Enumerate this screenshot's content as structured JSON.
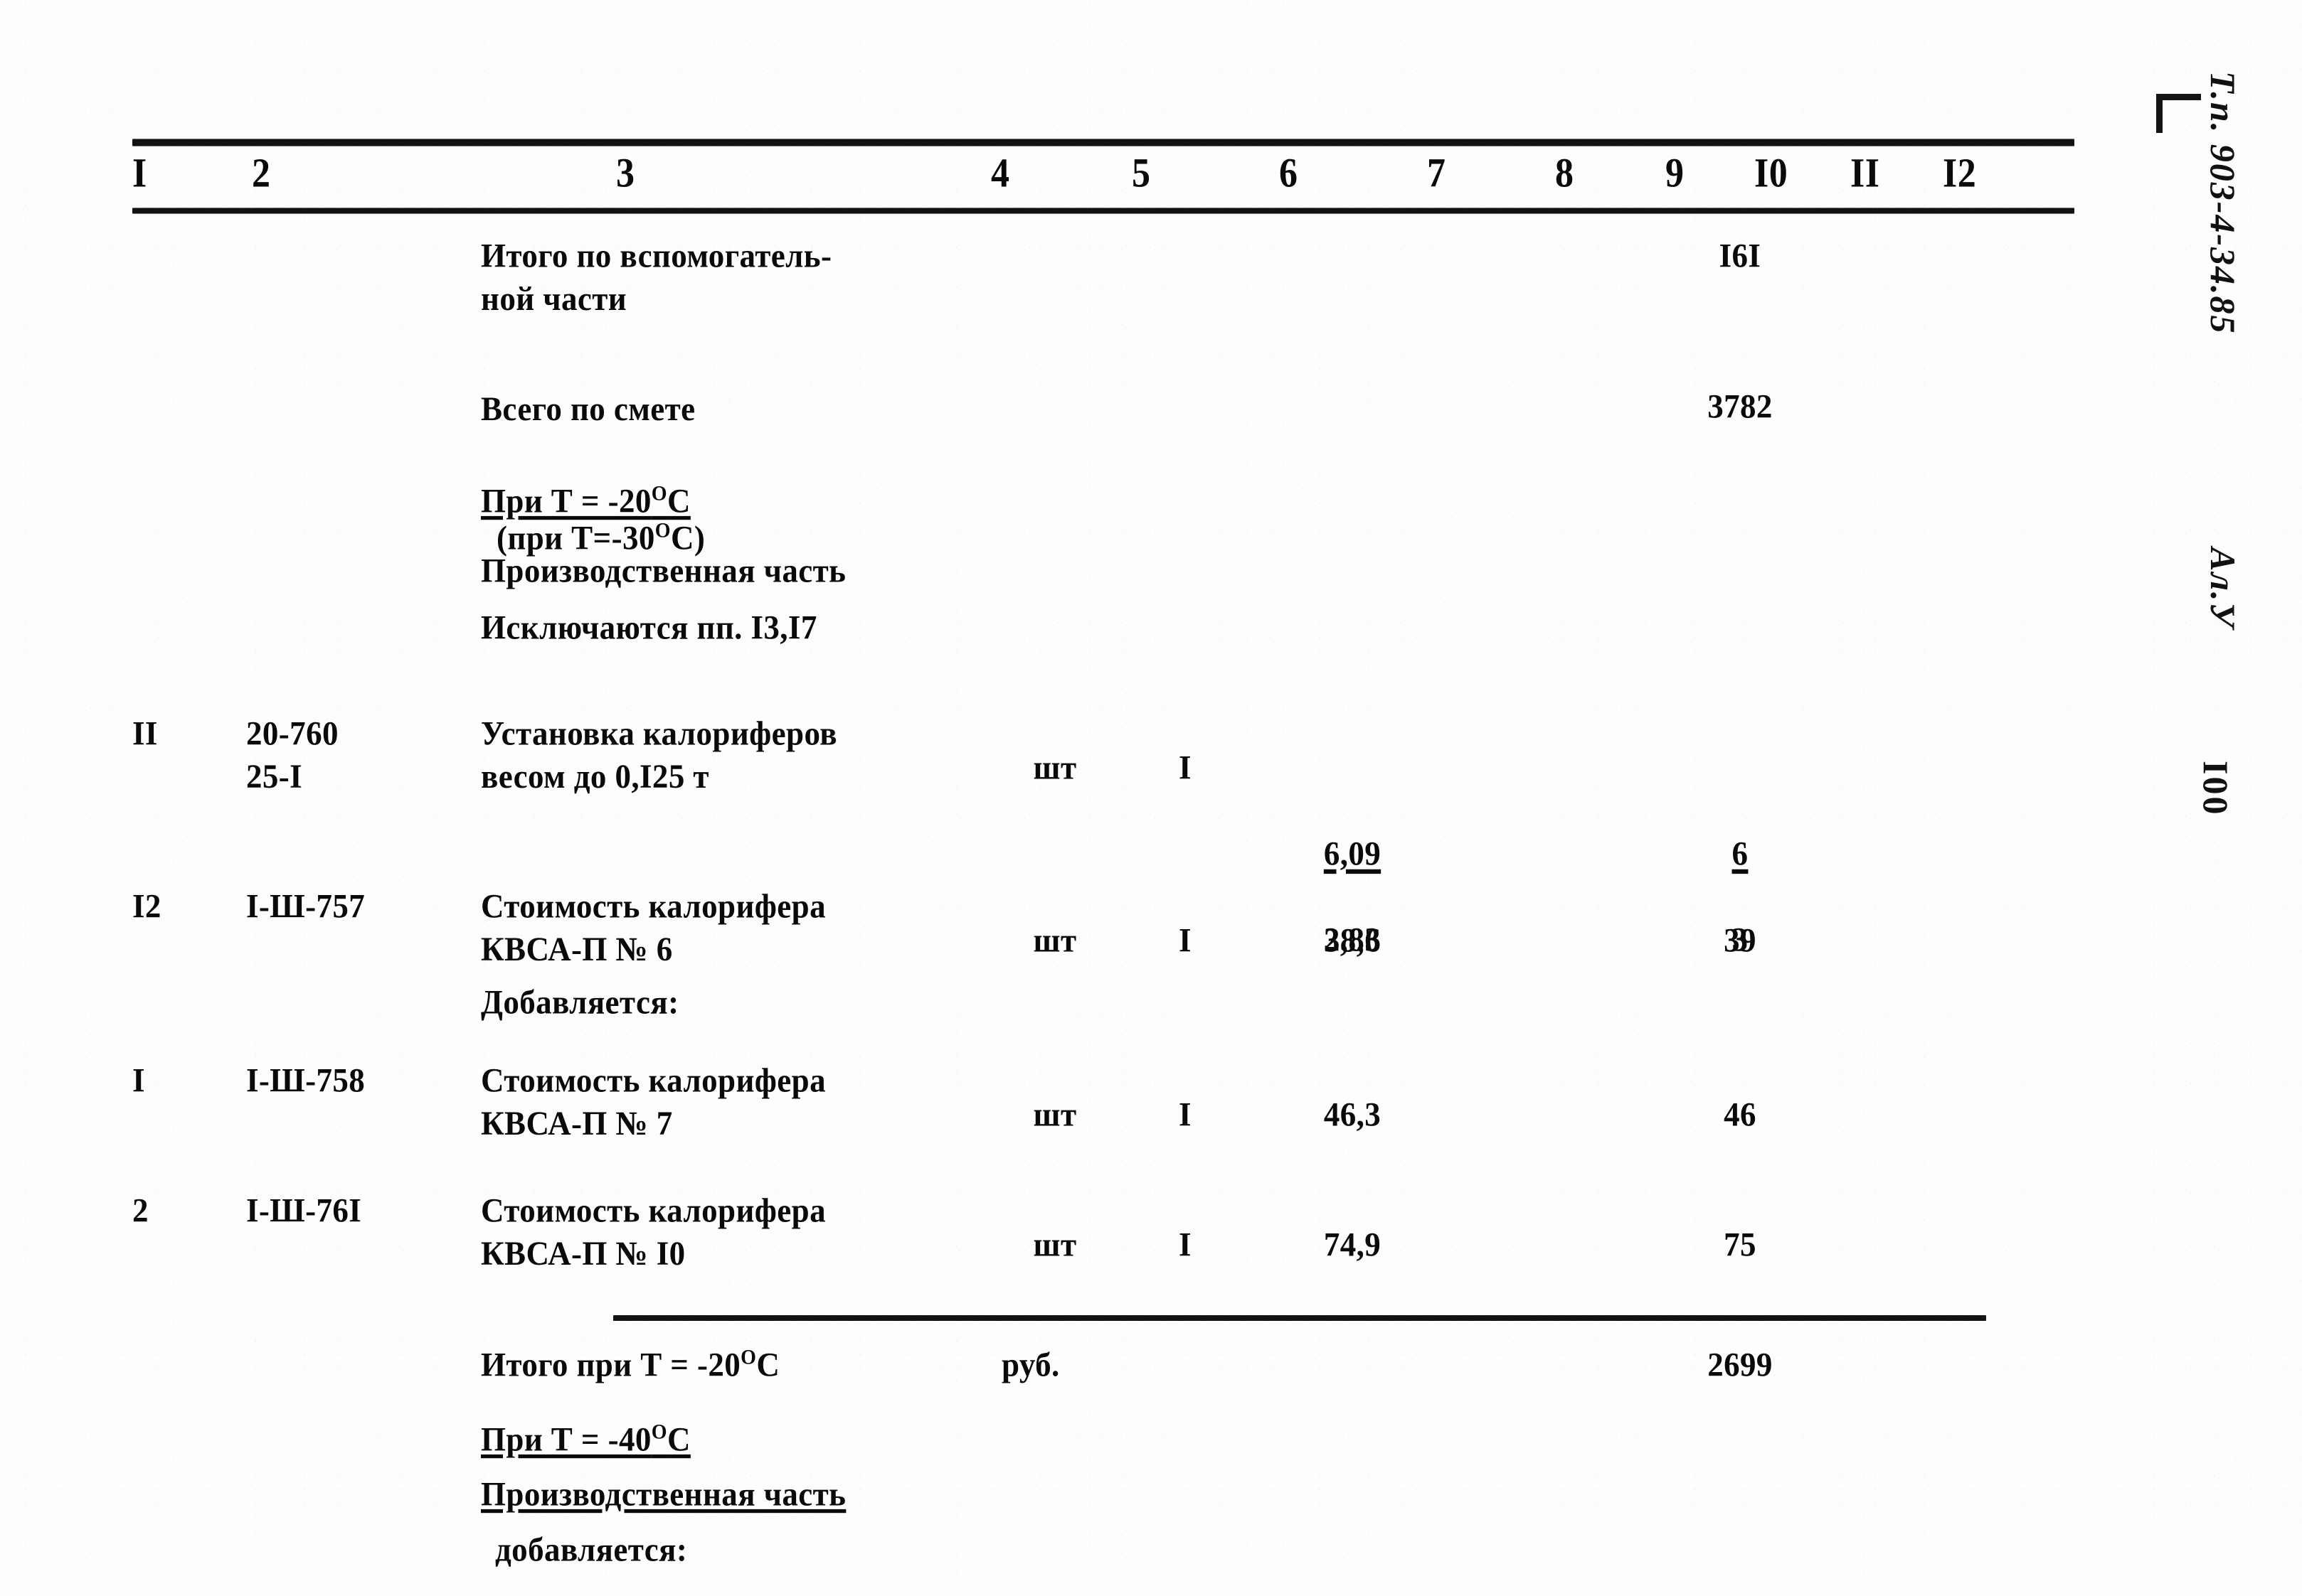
{
  "document": {
    "margin_stamp": {
      "code": "Т.п. 903-4-34.85",
      "album": "Ал.У",
      "page_number": "I00"
    }
  },
  "table": {
    "column_headers": [
      "I",
      "2",
      "3",
      "4",
      "5",
      "6",
      "7",
      "8",
      "9",
      "I0",
      "II",
      "I2"
    ],
    "rows": [
      {
        "id": "itogo-vspomogatelnoy",
        "c1": "",
        "c2": "",
        "c3": "Итого по вспомогатель-\nной части",
        "c4": "",
        "c5": "",
        "c6": "",
        "c9": "I6I"
      },
      {
        "id": "vsego-po-smete",
        "c1": "",
        "c2": "",
        "c3_line1": "Всего по смете",
        "c3_line2": "(при Т=-30",
        "c3_sup": "О",
        "c3_line2_tail": "С)",
        "c9": "3782"
      },
      {
        "id": "pri-t-minus-20",
        "c3": "При Т = -20",
        "c3_sup": "О",
        "c3_tail": "С"
      },
      {
        "id": "proizvodstvennaya-chast-20",
        "c3": "Производственная часть"
      },
      {
        "id": "isklyuchayutsya",
        "c3": "Исключаются пп. I3,I7"
      },
      {
        "id": "item-11",
        "c1": "II",
        "c2": "20-760\n25-I",
        "c3": "Установка калориферов\nвесом до 0,I25 т",
        "c4": "шт",
        "c5": "I",
        "c6_num": "6,09",
        "c6_den": "2,83",
        "c9_num": "6",
        "c9_den": "3"
      },
      {
        "id": "item-12",
        "c1": "I2",
        "c2": "I-Ш-757",
        "c3": "Стоимость калорифера\nКВСА-П № 6",
        "c4": "шт",
        "c5": "I",
        "c6": "38,6",
        "c9": "39"
      },
      {
        "id": "dobavlyaetsya-20",
        "c3": "Добавляется:"
      },
      {
        "id": "item-1",
        "c1": "I",
        "c2": "I-Ш-758",
        "c3": "Стоимость калорифера\nКВСА-П № 7",
        "c4": "шт",
        "c5": "I",
        "c6": "46,3",
        "c9": "46"
      },
      {
        "id": "item-2",
        "c1": "2",
        "c2": "I-Ш-76I",
        "c3": "Стоимость калорифера\nКВСА-П № I0",
        "c4": "шт",
        "c5": "I",
        "c6": "74,9",
        "c9": "75"
      },
      {
        "id": "itogo-pri-t-minus-20",
        "c3": "Итого при Т = -20",
        "c3_sup": "О",
        "c3_tail": "С",
        "c4": "руб.",
        "c9": "2699"
      },
      {
        "id": "pri-t-minus-40",
        "c3": "При Т = -40",
        "c3_sup": "О",
        "c3_tail": "С"
      },
      {
        "id": "proizvodstvennaya-chast-40",
        "c3": "Производственная часть"
      },
      {
        "id": "dobavlyaetsya-40",
        "c3": "добавляется:"
      }
    ]
  }
}
